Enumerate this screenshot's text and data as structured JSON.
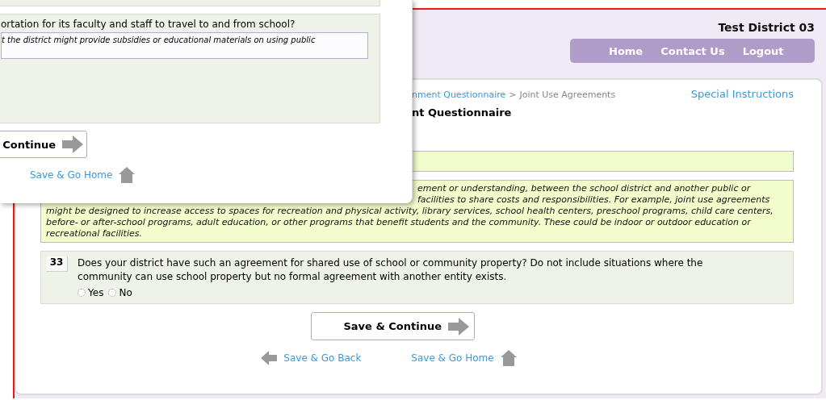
{
  "popup": {
    "question_text": "ortation for its faculty and staff to travel to and from school?",
    "answer_value": "t the district might provide subsidies or educational materials on using public",
    "continue_button": "Continue",
    "home_link": "Save & Go Home"
  },
  "header": {
    "district": "Test District 03",
    "nav": [
      "Home",
      "Contact Us",
      "Logout"
    ]
  },
  "breadcrumb": {
    "link": "nment Questionnaire",
    "separator": ">",
    "current": "Joint Use Agreements"
  },
  "special_instructions": "Special Instructions",
  "title": "nt Questionnaire",
  "description_partial_lines": [
    "ement or understanding, between the school district and another public or",
    "facilities to share costs and responsibilities. For example, joint use agreements"
  ],
  "description": "might be designed to increase access to spaces for recreation and physical activity, library services, school health centers, preschool programs, child care centers, before- or after-school programs, adult education, or other programs that benefit students and the community. These could be indoor or outdoor education or recreational facilities.",
  "question": {
    "number": "33",
    "text": "Does your district have such an agreement for shared use of school or community property? Do not include situations where the community can use school property but no formal agreement with another entity exists.",
    "options": [
      {
        "label": "Yes",
        "selected": false
      },
      {
        "label": "No",
        "selected": false
      }
    ]
  },
  "buttons": {
    "continue": "Save & Continue",
    "back": "Save & Go Back",
    "home": "Save & Go Home"
  }
}
